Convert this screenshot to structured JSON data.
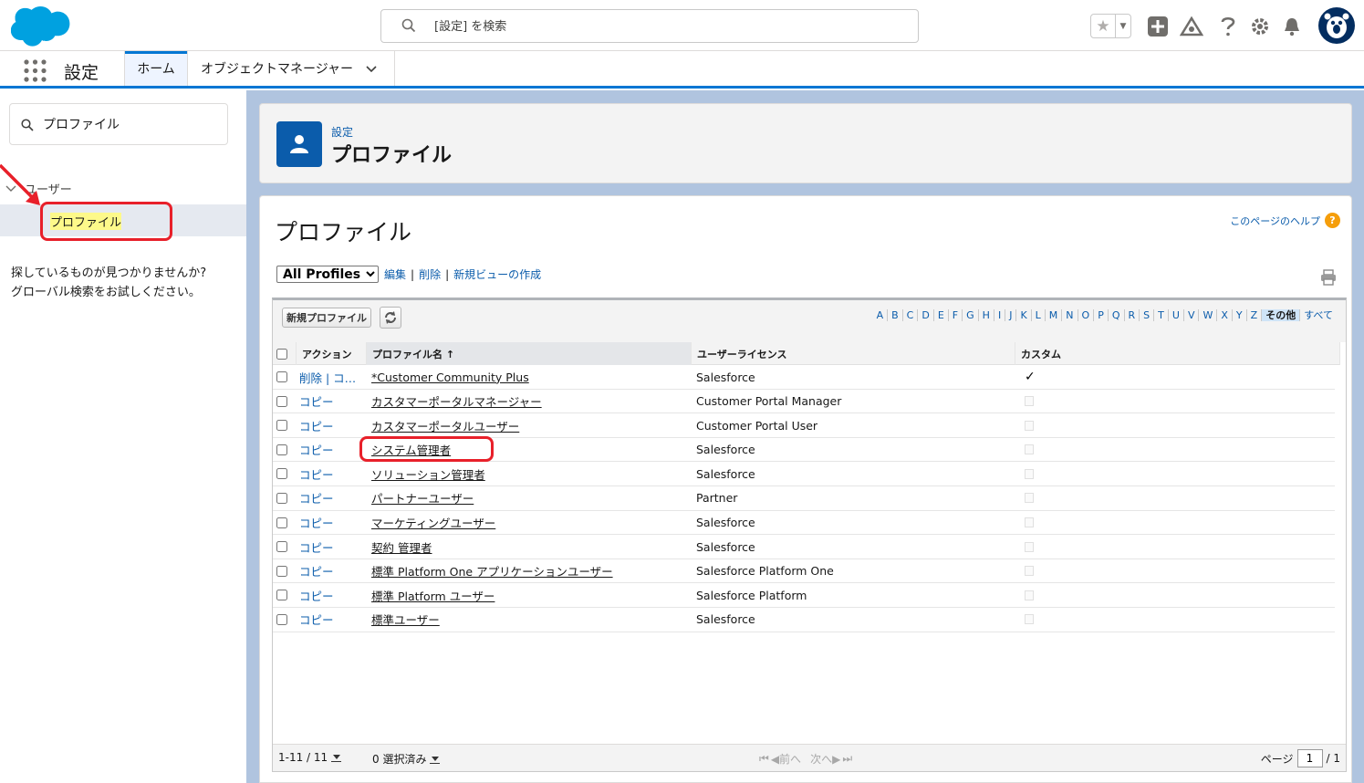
{
  "header": {
    "search_placeholder": "[設定] を検索"
  },
  "nav": {
    "app_name": "設定",
    "tabs": [
      {
        "label": "ホーム"
      },
      {
        "label": "オブジェクトマネージャー"
      }
    ]
  },
  "sidebar": {
    "quickfind_value": "プロファイル",
    "parent_label": "ユーザー",
    "child_label": "プロファイル",
    "notfound_line1": "探しているものが見つかりませんか?",
    "notfound_line2": "グローバル検索をお試しください。"
  },
  "page_header": {
    "breadcrumb": "設定",
    "title": "プロファイル"
  },
  "content": {
    "title": "プロファイル",
    "help_label": "このページのヘルプ",
    "view_select": "All Profiles",
    "edit_link": "編集",
    "delete_link": "削除",
    "new_view_link": "新規ビューの作成",
    "new_profile_button": "新規プロファイル",
    "alphabet": [
      "A",
      "B",
      "C",
      "D",
      "E",
      "F",
      "G",
      "H",
      "I",
      "J",
      "K",
      "L",
      "M",
      "N",
      "O",
      "P",
      "Q",
      "R",
      "S",
      "T",
      "U",
      "V",
      "W",
      "X",
      "Y",
      "Z",
      "その他",
      "すべて"
    ],
    "selected_letter": "その他"
  },
  "table": {
    "columns": {
      "action": "アクション",
      "name": "プロファイル名 ↑",
      "license": "ユーザーライセンス",
      "custom": "カスタム"
    },
    "rows": [
      {
        "action": "削除 | コ…",
        "name": "*Customer Community Plus",
        "license": "Salesforce",
        "custom": true
      },
      {
        "action": "コピー",
        "name": "カスタマーポータルマネージャー",
        "license": "Customer Portal Manager",
        "custom": false
      },
      {
        "action": "コピー",
        "name": "カスタマーポータルユーザー",
        "license": "Customer Portal User",
        "custom": false
      },
      {
        "action": "コピー",
        "name": "システム管理者",
        "license": "Salesforce",
        "custom": false
      },
      {
        "action": "コピー",
        "name": "ソリューション管理者",
        "license": "Salesforce",
        "custom": false
      },
      {
        "action": "コピー",
        "name": "パートナーユーザー",
        "license": "Partner",
        "custom": false
      },
      {
        "action": "コピー",
        "name": "マーケティングユーザー",
        "license": "Salesforce",
        "custom": false
      },
      {
        "action": "コピー",
        "name": "契約 管理者",
        "license": "Salesforce",
        "custom": false
      },
      {
        "action": "コピー",
        "name": "標準 Platform One アプリケーションユーザー",
        "license": "Salesforce Platform One",
        "custom": false
      },
      {
        "action": "コピー",
        "name": "標準 Platform ユーザー",
        "license": "Salesforce Platform",
        "custom": false
      },
      {
        "action": "コピー",
        "name": "標準ユーザー",
        "license": "Salesforce",
        "custom": false
      }
    ]
  },
  "footer": {
    "range": "1-11 / 11",
    "selected": "0 選択済み",
    "prev": "前へ",
    "next": "次へ",
    "page_label": "ページ",
    "page_value": "1",
    "page_total": "/ 1"
  },
  "colors": {
    "brand_blue": "#0176d3",
    "link": "#0b5cab",
    "annotation_red": "#e8202a",
    "highlight": "#fdf98a"
  }
}
